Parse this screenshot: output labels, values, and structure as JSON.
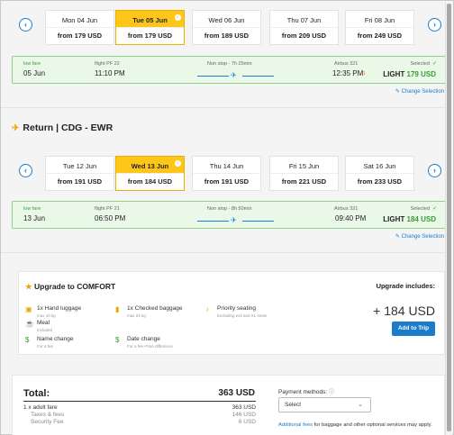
{
  "outbound": {
    "dates": [
      {
        "day": "Mon 04 Jun",
        "price": "from 179 USD",
        "selected": false
      },
      {
        "day": "Tue 05 Jun",
        "price": "from 179 USD",
        "selected": true
      },
      {
        "day": "Wed 06 Jun",
        "price": "from 189 USD",
        "selected": false
      },
      {
        "day": "Thu 07 Jun",
        "price": "from 209 USD",
        "selected": false
      },
      {
        "day": "Fri 08 Jun",
        "price": "from 249 USD",
        "selected": false
      }
    ],
    "flight": {
      "low_fare": "low fare",
      "date": "05 Jun",
      "flight_no": "flight PF 22",
      "depart": "11:10 PM",
      "stops": "Non stop - 7h 25min",
      "aircraft": "Airbus 321",
      "arrive": "12:35 PM",
      "day_offset": "+1",
      "selected": "Selected",
      "fare_class": "LIGHT",
      "fare_price": "179 USD"
    },
    "change_label": "Change Selection"
  },
  "return": {
    "title": "Return | CDG - EWR",
    "dates": [
      {
        "day": "Tue 12 Jun",
        "price": "from 191 USD",
        "selected": false
      },
      {
        "day": "Wed 13 Jun",
        "price": "from 184 USD",
        "selected": true
      },
      {
        "day": "Thu 14 Jun",
        "price": "from 191 USD",
        "selected": false
      },
      {
        "day": "Fri 15 Jun",
        "price": "from 221 USD",
        "selected": false
      },
      {
        "day": "Sat 16 Jun",
        "price": "from 233 USD",
        "selected": false
      }
    ],
    "flight": {
      "low_fare": "low fare",
      "date": "13 Jun",
      "flight_no": "flight PF 21",
      "depart": "06:50 PM",
      "stops": "Non stop - 8h 50min",
      "aircraft": "Airbus 321",
      "arrive": "09:40 PM",
      "selected": "Selected",
      "fare_class": "LIGHT",
      "fare_price": "184 USD"
    },
    "change_label": "Change Selection"
  },
  "upgrade": {
    "title": "Upgrade to COMFORT",
    "includes": "Upgrade includes:",
    "features": [
      {
        "title": "1x Hand luggage",
        "sub": "max 10 kg"
      },
      {
        "title": "1x Checked baggage",
        "sub": "max 23 kg"
      },
      {
        "title": "Priority seating",
        "sub": "Excluding exit and XL seats"
      },
      {
        "title": "Meal",
        "sub": "Included"
      },
      {
        "title": "Name change",
        "sub": "For a fee"
      },
      {
        "title": "Date change",
        "sub": "For a fee+Fare difference"
      }
    ],
    "price": "+ 184 USD",
    "button": "Add to Trip"
  },
  "total": {
    "label": "Total:",
    "value": "363 USD",
    "lines": [
      {
        "label": "1 x adult fare",
        "value": "363 USD"
      },
      {
        "label": "Taxes & fees",
        "value": "146 USD"
      },
      {
        "label": "Security Fee",
        "value": "6 USD"
      }
    ],
    "payment_label": "Payment methods:",
    "payment_select": "Select",
    "note_link": "Additional fees",
    "note_text": " for baggage and other optional services may apply."
  },
  "colors": {
    "accent": "#1a7ccb",
    "highlight": "#ffc61a",
    "green": "#3c9b36"
  }
}
